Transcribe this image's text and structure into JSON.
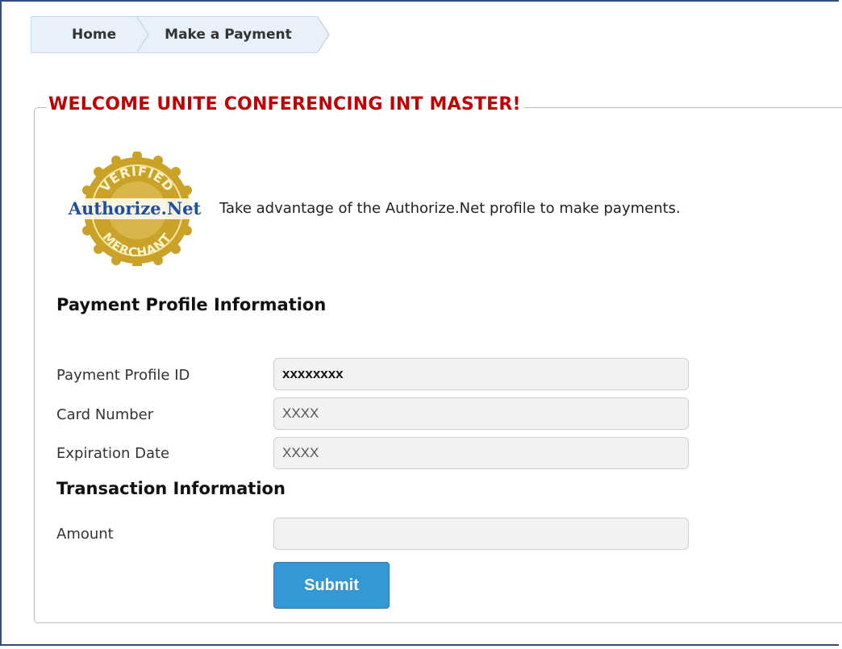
{
  "breadcrumb": {
    "home": "Home",
    "current": "Make a Payment"
  },
  "welcome": {
    "legend": "WELCOME UNITE CONFERENCING INT MASTER!"
  },
  "seal": {
    "top_text": "VERIFIED",
    "brand_text": "Authorize.Net",
    "bottom_text": "MERCHANT",
    "description": "Take advantage of the Authorize.Net profile to make payments."
  },
  "payment_profile": {
    "heading": "Payment Profile Information",
    "profile_id_label": "Payment Profile ID",
    "profile_id_value": "xxxxxxxx",
    "card_number_label": "Card Number",
    "card_number_value": "XXXX",
    "expiration_label": "Expiration Date",
    "expiration_value": "XXXX"
  },
  "transaction": {
    "heading": "Transaction Information",
    "amount_label": "Amount",
    "amount_value": "",
    "submit_label": "Submit"
  },
  "colors": {
    "accent_red": "#c00000",
    "button_blue": "#3498d4",
    "seal_gold": "#c9a227",
    "seal_blue": "#1f4e9c"
  }
}
